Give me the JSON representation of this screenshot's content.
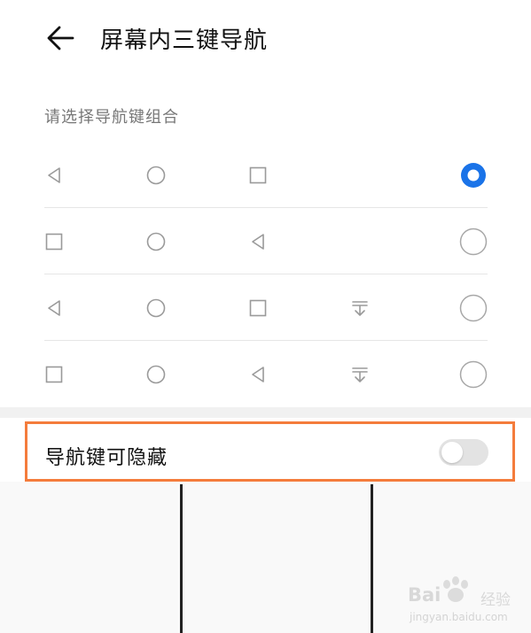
{
  "header": {
    "title": "屏幕内三键导航"
  },
  "section": {
    "label": "请选择导航键组合"
  },
  "options": [
    {
      "keys": [
        "back-triangle",
        "home-circle",
        "recent-square"
      ],
      "selected": true
    },
    {
      "keys": [
        "recent-square",
        "home-circle",
        "back-triangle"
      ],
      "selected": false
    },
    {
      "keys": [
        "back-triangle",
        "home-circle",
        "recent-square",
        "notification-pulldown"
      ],
      "selected": false
    },
    {
      "keys": [
        "recent-square",
        "home-circle",
        "back-triangle",
        "notification-pulldown"
      ],
      "selected": false
    }
  ],
  "hide_setting": {
    "label": "导航键可隐藏",
    "enabled": false
  },
  "colors": {
    "accent": "#1a73e8",
    "highlight_border": "#f47c3c"
  },
  "watermark": {
    "brand": "Bai",
    "suffix": "经验",
    "url": "jingyan.baidu.com"
  }
}
